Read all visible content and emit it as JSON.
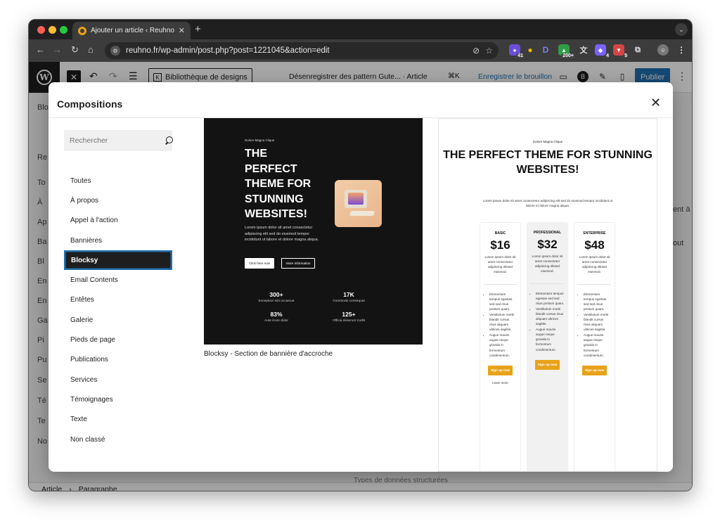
{
  "browser": {
    "tab_title": "Ajouter un article ‹ Reuhno —",
    "tab_close": "✕",
    "new_tab": "+",
    "url": "reuhno.fr/wp-admin/post.php?post=1221045&action=edit",
    "extensions": [
      {
        "name": "ext-purple",
        "badge": "41",
        "color": "#6a4fd6"
      },
      {
        "name": "ext-bulb",
        "badge": "",
        "color": "#f0b400"
      },
      {
        "name": "ext-d",
        "label": "D",
        "badge": "",
        "color": "#5b5bd6"
      },
      {
        "name": "ext-green",
        "badge": "200+",
        "color": "#2f9e44"
      },
      {
        "name": "ext-translate",
        "badge": "",
        "color": "#555555"
      },
      {
        "name": "ext-shield",
        "badge": "4",
        "color": "#7b61ff"
      },
      {
        "name": "ext-red",
        "badge": "5",
        "color": "#d64545"
      }
    ]
  },
  "wp_header": {
    "designs_label": "Bibliothèque de designs",
    "doc_title": "Désenregistrer des pattern Gute...  · Article",
    "shortcut": "⌘K",
    "save_draft": "Enregistrer le brouillon",
    "publish": "Publier"
  },
  "background": {
    "sidebar_fragments": [
      "Bloc",
      "Re",
      "To",
      "À",
      "Ap",
      "Ba",
      "Bl",
      "En",
      "En",
      "Ga",
      "Pi",
      "Pu",
      "Se",
      "Té",
      "Te",
      "No"
    ],
    "right_fragments": [
      "ent à",
      "out"
    ],
    "status_breadcrumb": [
      "Article",
      "›",
      "Paragraphe"
    ],
    "right_panel_text": "Types de données structurées"
  },
  "modal": {
    "title": "Compositions",
    "close": "✕",
    "search_placeholder": "Rechercher",
    "categories": [
      "Toutes",
      "À propos",
      "Appel à l'action",
      "Bannières",
      "Blocksy",
      "Email Contents",
      "Entêtes",
      "Galerie",
      "Pieds de page",
      "Publications",
      "Services",
      "Témoignages",
      "Texte",
      "Non classé"
    ],
    "active_category": "Blocksy"
  },
  "pattern1": {
    "eyebrow": "Dolore Magna Clique",
    "title": "THE PERFECT THEME FOR STUNNING WEBSITES!",
    "body": "Lorem ipsum dolor sit amet consectetur adipiscing elit sed do eiusmod tempor incididunt ut labore et dolore magna aliqua.",
    "btn_primary": "Click here now",
    "btn_secondary": "More information",
    "stats": [
      {
        "value": "300+",
        "label": "Excepteur sint occaecat"
      },
      {
        "value": "17K",
        "label": "Commodo consequat"
      },
      {
        "value": "83%",
        "label": "Aute iirure dolor"
      },
      {
        "value": "125+",
        "label": "Officia deserunt mollit"
      }
    ],
    "caption": "Blocksy - Section de bannière d'accroche",
    "accent": "#131313"
  },
  "pattern2": {
    "eyebrow": "Dolore Magna Clique",
    "title": "THE PERFECT THEME FOR STUNNING WEBSITES!",
    "body": "Lorem ipsum dolor sit amet consectetur adipiscing elit sed do eiusmod tempor incididunt ut labore et dolore magna aliqua.",
    "plans": [
      {
        "name": "BASIC",
        "price": "$16",
        "desc": "Lorem ipsum dolor sit amet consectetur adipiscing elitsed eiusmod.",
        "features": [
          "Elementum tempus egestas sed sed risus pretium quam.",
          "Vestibulum morbi blandit cursus risus aliquam ultrices sagittis.",
          "Augue mauris augue neque gravida in fermentum condimentum."
        ],
        "button": "Sign up now",
        "learn_more": "Learn more"
      },
      {
        "name": "PROFESSIONAL",
        "price": "$32",
        "desc": "Lorem ipsum dolor sit amet consectetur adipiscing elitsed eiusmod.",
        "features": [
          "Elementum tempus egestas sed sed risus pretium quam.",
          "Vestibulum morbi blandit cursus risus aliquam ultrices sagittis.",
          "Augue mauris augue neque gravida in fermentum condimentum."
        ],
        "button": "Sign up now",
        "learn_more": ""
      },
      {
        "name": "ENTERPRISE",
        "price": "$48",
        "desc": "Lorem ipsum dolor sit amet consectetur adipiscing elitsed eiusmod.",
        "features": [
          "Elementum tempus egestas sed sed risus pretium quam.",
          "Vestibulum morbi blandit cursus risus aliquam ultrices sagittis.",
          "Augue mauris augue neque gravida in fermentum condimentum."
        ],
        "button": "Sign up now",
        "learn_more": ""
      }
    ],
    "button_color": "#e8a21a"
  }
}
